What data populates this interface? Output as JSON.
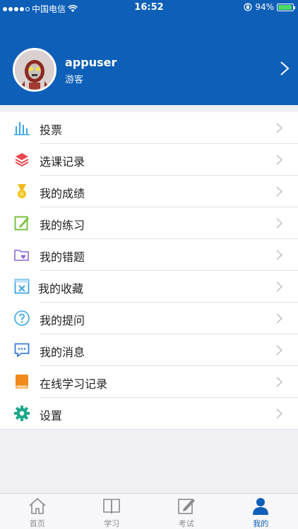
{
  "status_bar": {
    "carrier": "中国电信",
    "time": "16:52",
    "battery": "94%",
    "battery_level": 0.94
  },
  "profile": {
    "username": "appuser",
    "role": "游客"
  },
  "menu": [
    {
      "label": "投票",
      "icon": "bar-chart-icon"
    },
    {
      "label": "选课记录",
      "icon": "layers-icon"
    },
    {
      "label": "我的成绩",
      "icon": "medal-icon"
    },
    {
      "label": "我的练习",
      "icon": "edit-note-icon"
    },
    {
      "label": "我的错题",
      "icon": "folder-heart-icon"
    },
    {
      "label": "我的收藏",
      "icon": "favorite-box-icon"
    },
    {
      "label": "我的提问",
      "icon": "question-circle-icon"
    },
    {
      "label": "我的消息",
      "icon": "chat-bubble-icon"
    },
    {
      "label": "在线学习记录",
      "icon": "book-icon"
    },
    {
      "label": "设置",
      "icon": "gear-icon"
    }
  ],
  "tabs": [
    {
      "label": "首页",
      "icon": "home-icon"
    },
    {
      "label": "学习",
      "icon": "open-book-icon"
    },
    {
      "label": "考试",
      "icon": "pencil-paper-icon"
    },
    {
      "label": "我的",
      "icon": "person-icon"
    }
  ],
  "colors": {
    "brand": "#0e5fb8",
    "inactive_tab": "#8a8a8f"
  }
}
